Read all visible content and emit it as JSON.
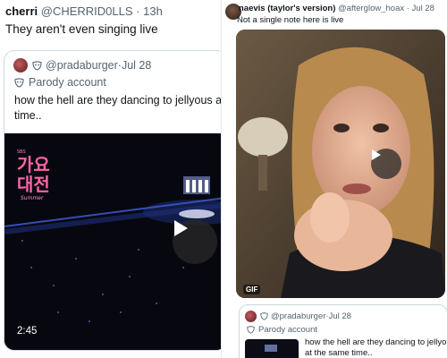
{
  "left_tweet": {
    "name": "cherri",
    "handle": "@CHERRID0LLS",
    "separator": " · ",
    "time": "13h",
    "text": "They aren't even singing live",
    "quote": {
      "handle": "@pradaburger",
      "separator": " · ",
      "date": "Jul 28",
      "parody_label": "Parody account",
      "text_line1": "how the hell are they dancing to jellyous an",
      "text_line2": "time..",
      "video_duration": "2:45"
    }
  },
  "right_tweet": {
    "name": "naevis (taylor's version)",
    "handle": "@afterglow_hoax",
    "separator": " · ",
    "date": "Jul 28",
    "text": "Not a single note here is live",
    "gif_badge": "GIF",
    "quote": {
      "handle": "@pradaburger",
      "separator": " · ",
      "date": "Jul 28",
      "parody_label": "Parody account",
      "text_line1": "how the hell are they dancing to jellyous a",
      "text_line2": "at the same time.."
    }
  },
  "icons": {
    "play": "play-icon",
    "parody": "parody-mask-icon",
    "avatar": "avatar"
  },
  "colors": {
    "text_primary": "#0f1419",
    "text_muted": "#536471",
    "border": "#cfd9de"
  }
}
